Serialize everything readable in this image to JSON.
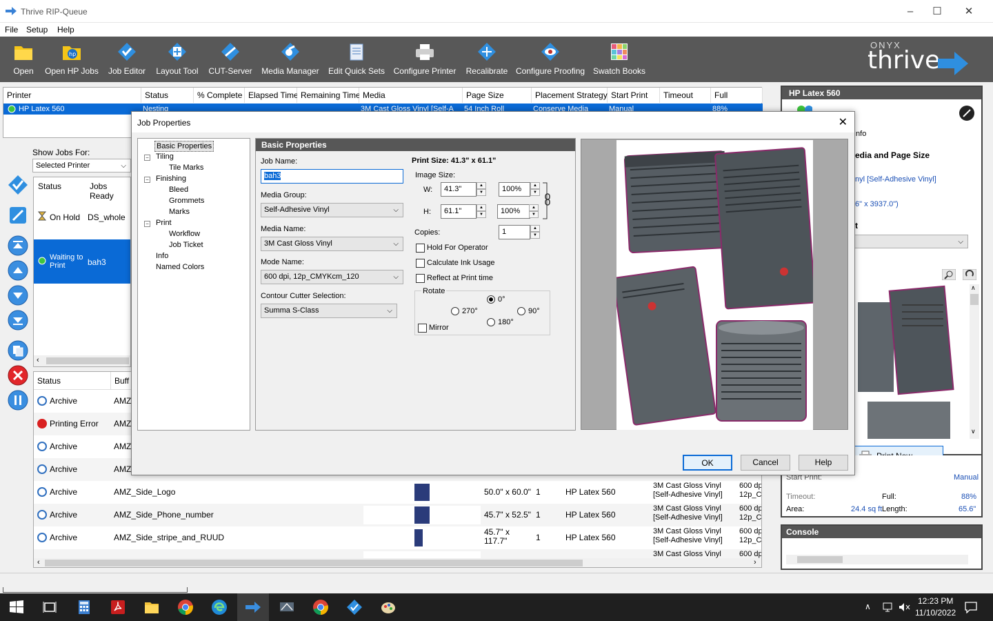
{
  "app": {
    "title": "Thrive RIP-Queue",
    "accent": "#0a6ad6"
  },
  "menu": [
    "File",
    "Setup",
    "Help"
  ],
  "toolbar": [
    {
      "label": "Open",
      "icon": "folder-icon"
    },
    {
      "label": "Open HP Jobs",
      "icon": "hp-folder-icon"
    },
    {
      "label": "Job Editor",
      "icon": "job-editor-icon"
    },
    {
      "label": "Layout Tool",
      "icon": "layout-tool-icon"
    },
    {
      "label": "CUT-Server",
      "icon": "cut-server-icon"
    },
    {
      "label": "Media Manager",
      "icon": "media-manager-icon"
    },
    {
      "label": "Edit Quick Sets",
      "icon": "quick-sets-icon"
    },
    {
      "label": "Configure Printer",
      "icon": "printer-icon"
    },
    {
      "label": "Recalibrate",
      "icon": "recalibrate-icon"
    },
    {
      "label": "Configure Proofing",
      "icon": "proofing-eye-icon"
    },
    {
      "label": "Swatch Books",
      "icon": "swatch-grid-icon"
    }
  ],
  "logo": {
    "small": "ONYX",
    "big": "thrive"
  },
  "printer_table": {
    "headers": [
      "Printer",
      "Status",
      "% Complete",
      "Elapsed Time",
      "Remaining Time",
      "Media",
      "Page Size",
      "Placement Strategy",
      "Start Print",
      "Timeout",
      "Full"
    ],
    "row": {
      "printer": "HP Latex 560",
      "status": "Nesting",
      "media": "3M Cast Gloss Vinyl [Self-A",
      "page_size": "54 Inch Roll",
      "placement": "Conserve Media",
      "start_print": "Manual",
      "full": "88%"
    }
  },
  "left_panel": {
    "show_jobs_for": "Show Jobs For:",
    "selected": "Selected Printer",
    "headers": [
      "Status",
      "Jobs Ready"
    ],
    "rows": [
      {
        "status": "On Hold",
        "job": "DS_whole"
      },
      {
        "status_line1": "Waiting to",
        "status_line2": "Print",
        "job": "bah3"
      }
    ]
  },
  "jobs_table": {
    "headers": [
      "Status",
      "Buff"
    ],
    "rows": [
      {
        "status": "Archive",
        "name": "AMZ_",
        "size": "",
        "copies": "",
        "printer": "",
        "media1": "",
        "media2": "",
        "mode1": "",
        "mode2": ""
      },
      {
        "status": "Printing Error",
        "name": "AMZ_",
        "size": "",
        "copies": "",
        "printer": "",
        "media1": "",
        "media2": "",
        "mode1": "",
        "mode2": ""
      },
      {
        "status": "Archive",
        "name": "AMZ_",
        "size": "",
        "copies": "",
        "printer": "",
        "media1": "",
        "media2": "",
        "mode1": "",
        "mode2": ""
      },
      {
        "status": "Archive",
        "name": "AMZ_",
        "size": "",
        "copies": "",
        "printer": "",
        "media1": "",
        "media2": "",
        "mode1": "",
        "mode2": ""
      },
      {
        "status": "Archive",
        "name": "AMZ_Side_Logo",
        "size": "50.0\" x 60.0\"",
        "copies": "1",
        "printer": "HP Latex 560",
        "media1": "3M Cast Gloss Vinyl",
        "media2": "[Self-Adhesive Vinyl]",
        "mode1": "600 dp",
        "mode2": "12p_Cl"
      },
      {
        "status": "Archive",
        "name": "AMZ_Side_Phone_number",
        "size": "45.7\" x 52.5\"",
        "copies": "1",
        "printer": "HP Latex 560",
        "media1": "3M Cast Gloss Vinyl",
        "media2": "[Self-Adhesive Vinyl]",
        "mode1": "600 dp",
        "mode2": "12p_Cl"
      },
      {
        "status": "Archive",
        "name": "AMZ_Side_stripe_and_RUUD",
        "size": "45.7\" x",
        "size2": "117.7\"",
        "copies": "1",
        "printer": "HP Latex 560",
        "media1": "3M Cast Gloss Vinyl",
        "media2": "[Self-Adhesive Vinyl]",
        "mode1": "600 dp",
        "mode2": "12p_Cl"
      },
      {
        "status": "",
        "name": "",
        "size": "",
        "copies": "",
        "printer": "",
        "media1": "3M Cast Gloss Vinyl",
        "media2": "",
        "mode1": "600 dp",
        "mode2": ""
      }
    ]
  },
  "right_panel": {
    "title": "HP Latex 560",
    "tab": "Info",
    "section": "edia and Page Size",
    "media": "nyl [Self-Adhesive Vinyl]",
    "size": "6\" x 3937.0\")",
    "frag": "t",
    "print_now": "Print Now",
    "start_print_label": "Start Print:",
    "start_print_value": "Manual",
    "timeout_label": "Timeout:",
    "full_label": "Full:",
    "full_value": "88%",
    "area_label": "Area:",
    "area_value": "24.4 sq ft",
    "length_label": "Length:",
    "length_value": "65.6\""
  },
  "console": {
    "title": "Console"
  },
  "dialog": {
    "title": "Job Properties",
    "tree": [
      {
        "label": "Basic Properties",
        "level": 0,
        "selected": true
      },
      {
        "label": "Tiling",
        "level": 0
      },
      {
        "label": "Tile Marks",
        "level": 1
      },
      {
        "label": "Finishing",
        "level": 0
      },
      {
        "label": "Bleed",
        "level": 1
      },
      {
        "label": "Grommets",
        "level": 1
      },
      {
        "label": "Marks",
        "level": 1
      },
      {
        "label": "Print",
        "level": 0
      },
      {
        "label": "Workflow",
        "level": 1
      },
      {
        "label": "Job Ticket",
        "level": 1
      },
      {
        "label": "Info",
        "level": 0
      },
      {
        "label": "Named Colors",
        "level": 0
      }
    ],
    "basic": {
      "header": "Basic Properties",
      "job_name_label": "Job Name:",
      "job_name": "bah3",
      "media_group_label": "Media Group:",
      "media_group": "Self-Adhesive Vinyl",
      "media_name_label": "Media Name:",
      "media_name": "3M Cast Gloss Vinyl",
      "mode_label": "Mode Name:",
      "mode": "600 dpi, 12p_CMYKcm_120",
      "cutter_label": "Contour Cutter Selection:",
      "cutter": "Summa S-Class",
      "print_size": "Print Size: 41.3\" x 61.1\"",
      "image_size_label": "Image Size:",
      "w_label": "W:",
      "w": "41.3\"",
      "w_pct": "100%",
      "h_label": "H:",
      "h": "61.1\"",
      "h_pct": "100%",
      "copies_label": "Copies:",
      "copies": "1",
      "hold": "Hold For Operator",
      "calc_ink": "Calculate Ink Usage",
      "reflect": "Reflect at Print time",
      "rotate_label": "Rotate",
      "r0": "0°",
      "r270": "270°",
      "r90": "90°",
      "r180": "180°",
      "mirror": "Mirror"
    },
    "buttons": {
      "ok": "OK",
      "cancel": "Cancel",
      "help": "Help"
    }
  },
  "taskbar": {
    "time": "12:23 PM",
    "date": "11/10/2022"
  }
}
